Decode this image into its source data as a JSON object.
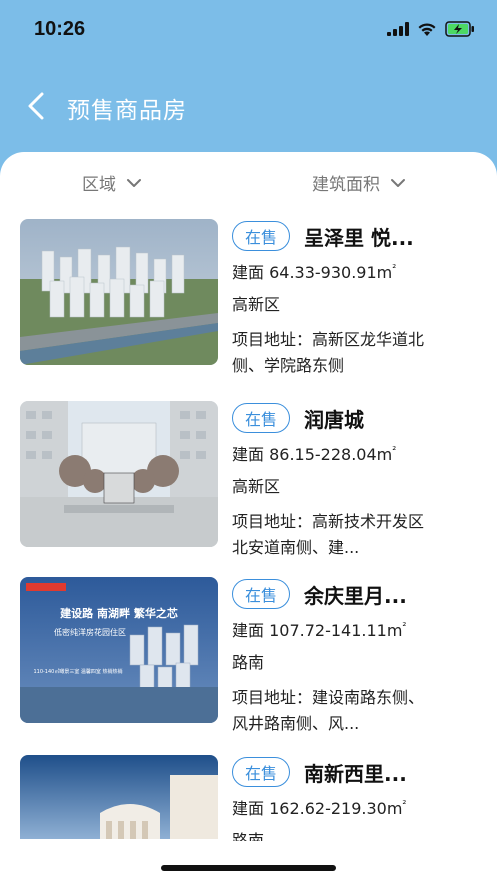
{
  "status": {
    "time": "10:26"
  },
  "nav": {
    "title": "预售商品房"
  },
  "filters": {
    "region": "区域",
    "area": "建筑面积"
  },
  "listings": [
    {
      "status": "在售",
      "name": "呈泽里 悦...",
      "area_prefix": "建面 64.33-930.91m",
      "area_unit_sup": "²",
      "district": "高新区",
      "address": "项目地址：高新区龙华道北侧、学院路东侧"
    },
    {
      "status": "在售",
      "name": "润唐城",
      "area_prefix": "建面 86.15-228.04m",
      "area_unit_sup": "²",
      "district": "高新区",
      "address": "项目地址：高新技术开发区北安道南侧、建..."
    },
    {
      "status": "在售",
      "name": "余庆里月...",
      "area_prefix": "建面 107.72-141.11m",
      "area_unit_sup": "²",
      "district": "路南",
      "address": "项目地址：建设南路东侧、风井路南侧、风...",
      "thumb_text": {
        "line1": "建设路 南湖畔 繁华之芯",
        "line2": "低密纯洋房花园住区",
        "line3": "110-140㎡瞰景三室 温馨四室 热销热销"
      }
    },
    {
      "status": "在售",
      "name": "南新西里...",
      "area_prefix": "建面 162.62-219.30m",
      "area_unit_sup": "²",
      "district": "路南",
      "address": ""
    }
  ],
  "colors": {
    "header_bg": "#7cbde8",
    "accent": "#3b8fdc"
  }
}
